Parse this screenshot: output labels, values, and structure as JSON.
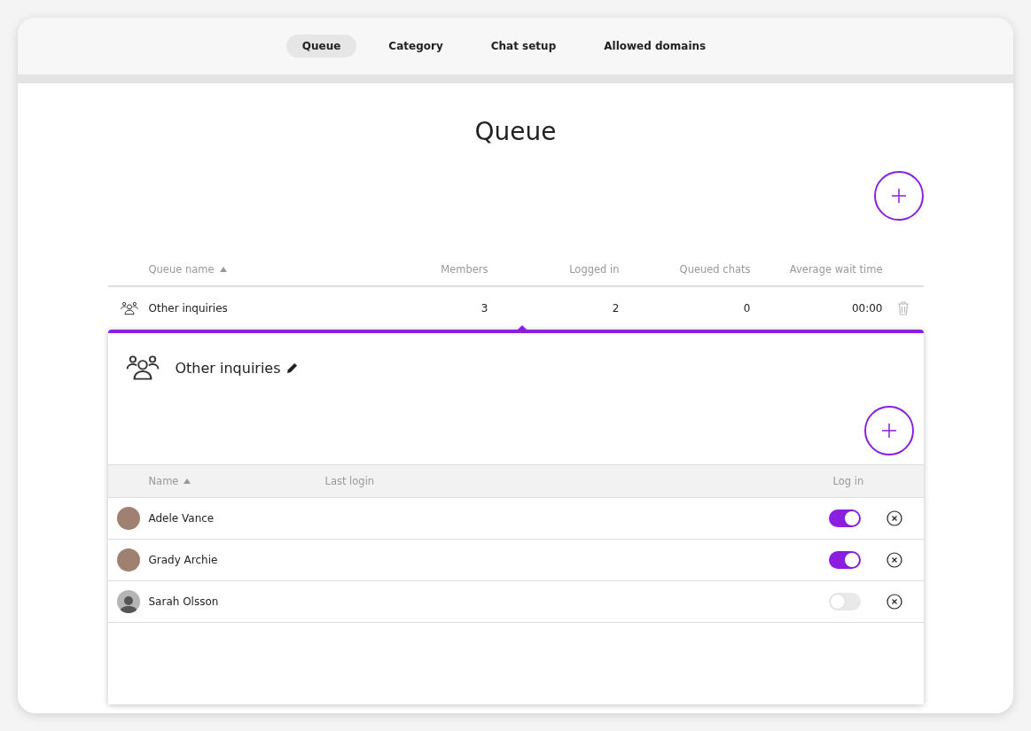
{
  "tabs": [
    {
      "label": "Queue",
      "selected": true
    },
    {
      "label": "Category",
      "selected": false
    },
    {
      "label": "Chat setup",
      "selected": false
    },
    {
      "label": "Allowed domains",
      "selected": false
    }
  ],
  "page_title": "Queue",
  "table": {
    "columns": [
      {
        "label": "Queue name",
        "sorted": true
      },
      {
        "label": "Members",
        "sorted": false
      },
      {
        "label": "Logged in",
        "sorted": false
      },
      {
        "label": "Queued chats",
        "sorted": false
      },
      {
        "label": "Average wait time",
        "sorted": false
      }
    ],
    "rows": [
      {
        "name": "Other inquiries",
        "members": "3",
        "logged_in": "2",
        "queued_chats": "0",
        "average_wait_time": "00:00",
        "expanded": true
      }
    ]
  },
  "detail": {
    "title": "Other inquiries",
    "columns": [
      {
        "label": "Name",
        "sorted": true
      },
      {
        "label": "Last login",
        "sorted": false
      },
      {
        "label": "Log in",
        "sorted": false
      }
    ],
    "members": [
      {
        "name": "Adele Vance",
        "kind": "photo",
        "logged_in": true
      },
      {
        "name": "Grady Archie",
        "kind": "photo",
        "logged_in": true
      },
      {
        "name": "Sarah Olsson",
        "kind": "silhouette",
        "logged_in": false
      }
    ]
  }
}
